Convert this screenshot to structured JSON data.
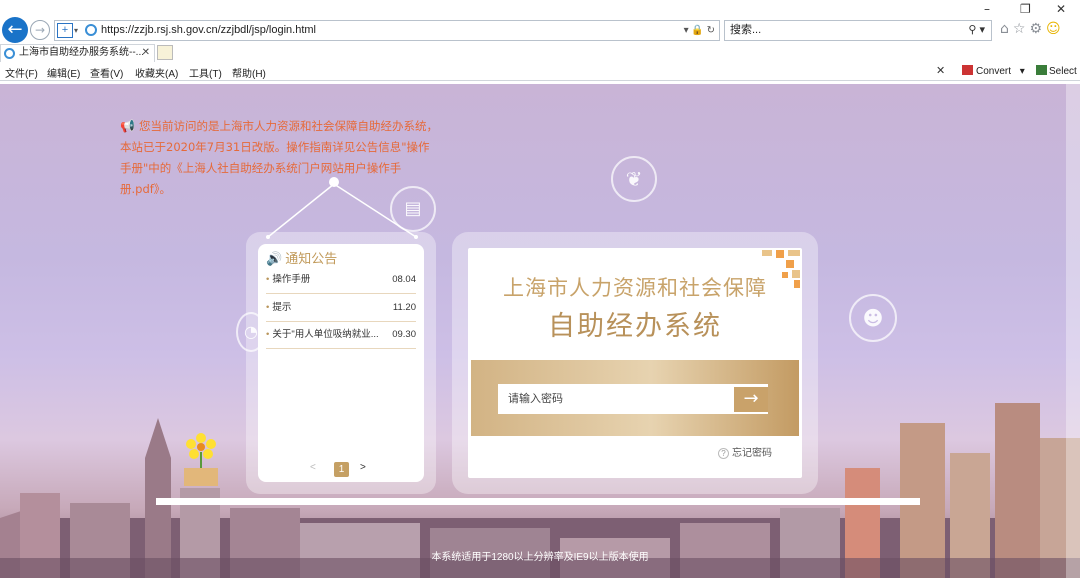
{
  "browser": {
    "url": "https://zzjb.rsj.sh.gov.cn/zzjbdl/jsp/login.html",
    "search_placeholder": "搜索...",
    "tab_title": "上海市自助经办服务系统--...",
    "menu": [
      "文件(F)",
      "编辑(E)",
      "查看(V)",
      "收藏夹(A)",
      "工具(T)",
      "帮助(H)"
    ],
    "toolbar": {
      "convert_label": "Convert",
      "select_label": "Select"
    }
  },
  "notice": {
    "text": "您当前访问的是上海市人力资源和社会保障自助经办系统，本站已于2020年7月31日改版。操作指南详见公告信息\"操作手册\"中的《上海人社自助经办系统门户网站用户操作手册.pdf》。"
  },
  "news": {
    "title": "通知公告",
    "items": [
      {
        "label": "操作手册",
        "date": "08.04"
      },
      {
        "label": "提示",
        "date": "11.20"
      },
      {
        "label": "关于\"用人单位吸纳就业...",
        "date": "09.30"
      }
    ],
    "pager": {
      "prev": "<",
      "current": "1",
      "next": ">"
    }
  },
  "login": {
    "title_line1": "上海市人力资源和社会保障",
    "title_line2": "自助经办系统",
    "password_placeholder": "请输入密码",
    "submit_arrow": "→",
    "forgot_label": "忘记密码"
  },
  "footer": {
    "note": "本系统适用于1280以上分辨率及IE9以上版本使用"
  },
  "colors": {
    "accent_gold": "#c8a36a",
    "notice_orange": "#e66a3a",
    "ie_blue": "#1a73c8"
  }
}
